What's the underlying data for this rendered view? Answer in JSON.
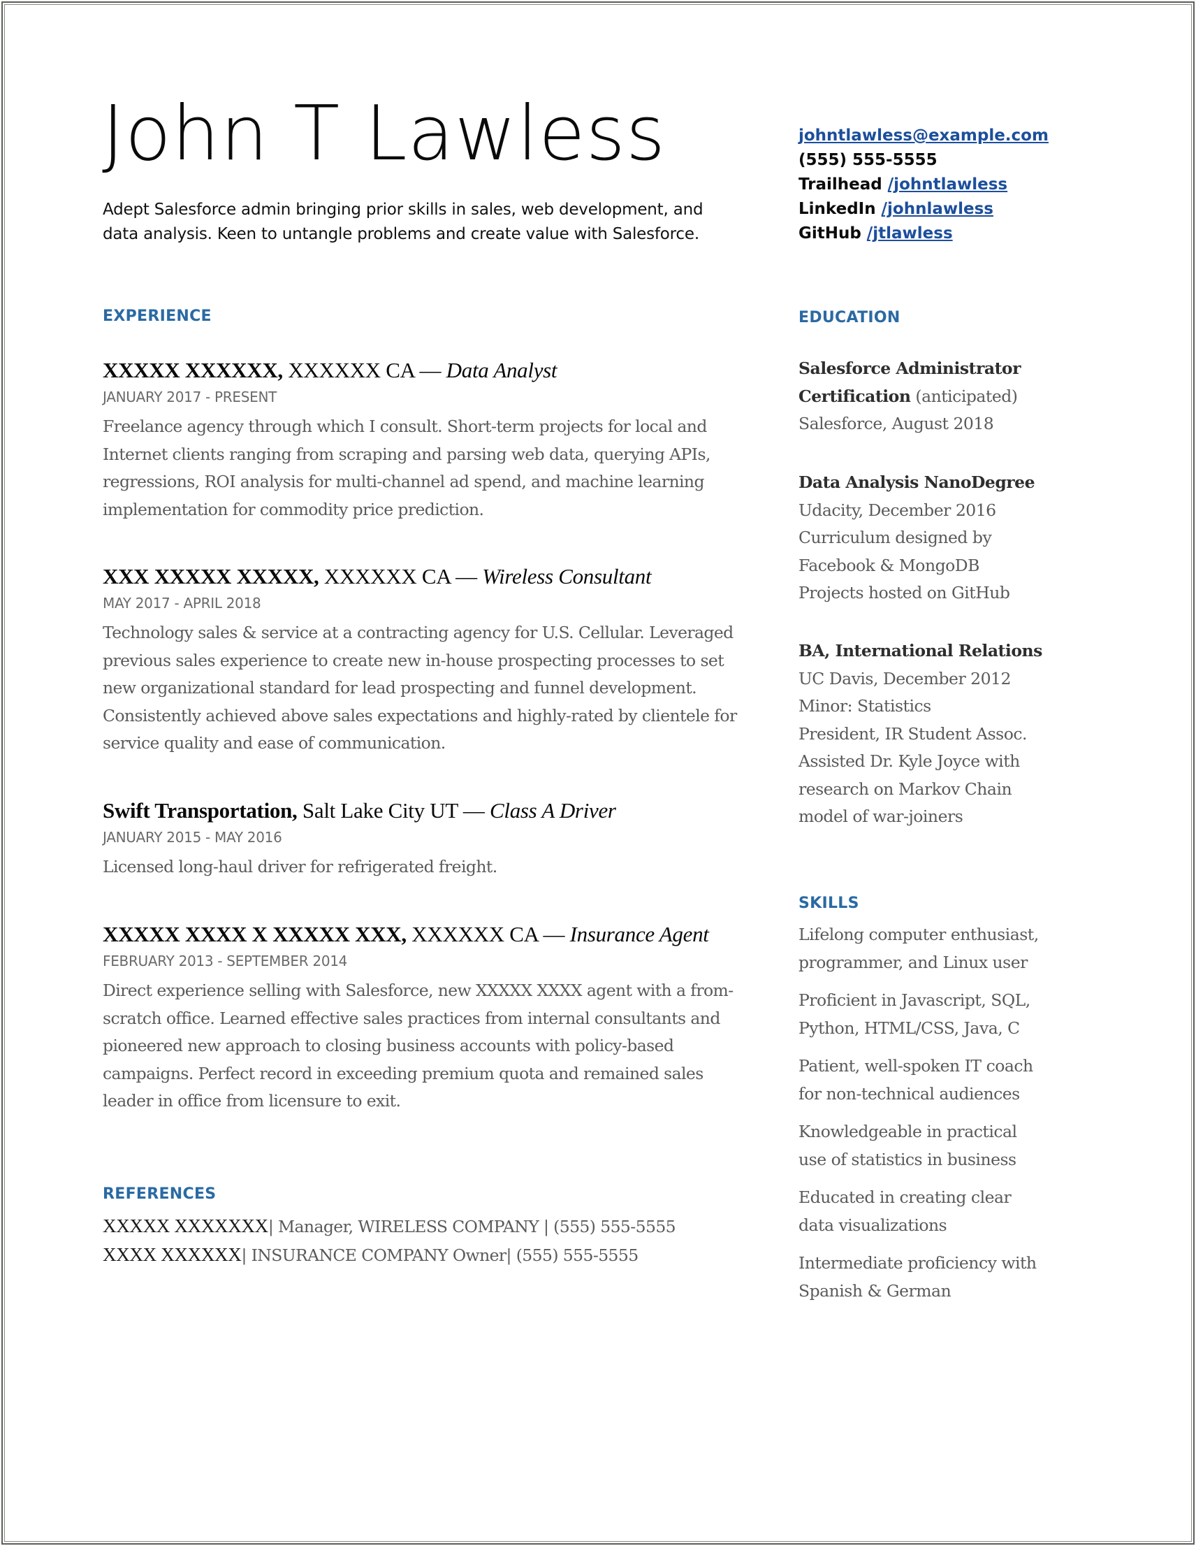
{
  "header": {
    "name": "John T Lawless",
    "summary": "Adept Salesforce admin bringing prior skills in sales, web development, and data analysis. Keen to untangle problems and create value with Salesforce."
  },
  "contact": {
    "email": "johntlawless@example.com",
    "phone": "(555) 555-5555",
    "trailhead_label": "Trailhead",
    "trailhead_link": "/johntlawless",
    "linkedin_label": "LinkedIn",
    "linkedin_link": "/johnlawless",
    "github_label": "GitHub",
    "github_link": "/jtlawless"
  },
  "experience": {
    "title": "EXPERIENCE",
    "jobs": [
      {
        "org": "XXXXX XXXXXX,",
        "location": " XXXXXX CA — ",
        "role": "Data Analyst",
        "date": "JANUARY 2017 - PRESENT",
        "desc": "Freelance agency through which I consult. Short-term projects for local and Internet clients ranging from scraping and parsing web data, querying APIs, regressions, ROI analysis for multi-channel ad spend, and machine learning implementation for commodity price prediction."
      },
      {
        "org": "XXX XXXXX XXXXX,",
        "location": " XXXXXX CA — ",
        "role": "Wireless Consultant",
        "date": "MAY 2017 - APRIL 2018",
        "desc": "Technology sales & service at a contracting agency for U.S. Cellular. Leveraged previous sales experience to create new in-house prospecting processes to set new organizational standard for lead prospecting and funnel development. Consistently achieved above sales expectations and highly-rated by clientele for service quality and ease of communication."
      },
      {
        "org": "Swift Transportation,",
        "location": " Salt Lake City UT — ",
        "role": "Class A Driver",
        "date": "JANUARY 2015 - MAY 2016",
        "desc": "Licensed long-haul driver for refrigerated freight."
      },
      {
        "org": "XXXXX XXXX X XXXXX XXX,",
        "location": " XXXXXX CA — ",
        "role": "Insurance Agent",
        "date": "FEBRUARY 2013 - SEPTEMBER 2014",
        "desc": "Direct experience selling with Salesforce, new XXXXX XXXX agent with a from-scratch office. Learned effective sales practices from internal consultants and pioneered new approach to closing business accounts with policy-based campaigns. Perfect record in exceeding premium quota and remained sales leader in office from licensure to exit."
      }
    ]
  },
  "references": {
    "title": "REFERENCES",
    "items": [
      {
        "name": "XXXXX XXXXXXX",
        "detail": "| Manager, WIRELESS COMPANY | (555) 555-5555"
      },
      {
        "name": "XXXX XXXXXX",
        "detail": "| INSURANCE COMPANY Owner| (555) 555-5555"
      }
    ]
  },
  "education": {
    "title": "EDUCATION",
    "items": [
      {
        "title_line1": "Salesforce Administrator",
        "title_line2": "Certification",
        "note": " (anticipated)",
        "lines": [
          "Salesforce, August 2018"
        ]
      },
      {
        "title_line1": "Data Analysis NanoDegree",
        "lines": [
          "Udacity, December 2016",
          "Curriculum designed by",
          "Facebook & MongoDB",
          "Projects hosted on GitHub"
        ]
      },
      {
        "title_line1": "BA, International Relations",
        "lines": [
          "UC Davis, December 2012",
          "Minor: Statistics",
          "President, IR Student Assoc.",
          "Assisted Dr. Kyle Joyce with",
          "research on Markov Chain",
          "model of war-joiners"
        ]
      }
    ]
  },
  "skills": {
    "title": "SKILLS",
    "items": [
      [
        "Lifelong computer enthusiast,",
        "programmer, and Linux user"
      ],
      [
        "Proficient in Javascript, SQL,",
        "Python, HTML/CSS, Java, C"
      ],
      [
        "Patient, well-spoken IT coach",
        "for non-technical audiences"
      ],
      [
        "Knowledgeable in practical",
        "use of statistics in business"
      ],
      [
        "Educated in creating clear",
        "data visualizations"
      ],
      [
        "Intermediate proficiency with",
        "Spanish & German"
      ]
    ]
  },
  "colors": {
    "accent": "#2a6aa3",
    "link": "#1c4f9c",
    "body_text": "#5a5a5a"
  }
}
